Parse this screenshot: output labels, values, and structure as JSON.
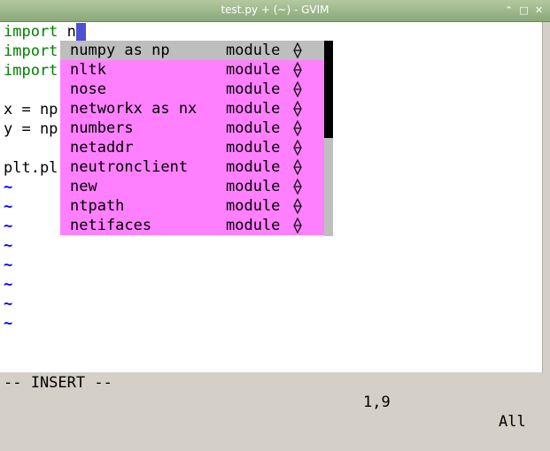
{
  "window": {
    "title": "test.py + (~) - GVIM"
  },
  "window_buttons": {
    "collapse": "⌃",
    "maximize": "□",
    "close": "✕"
  },
  "editor": {
    "lines": [
      {
        "keyword": "import",
        "text": " n",
        "cursor": true
      },
      {
        "keyword": "import",
        "text": ""
      },
      {
        "keyword": "import",
        "text": ""
      },
      {
        "keyword": "",
        "text": ""
      },
      {
        "keyword": "",
        "text": "x = np"
      },
      {
        "keyword": "",
        "text": "y = np"
      },
      {
        "keyword": "",
        "text": ""
      },
      {
        "keyword": "",
        "text": "plt.pl"
      }
    ],
    "tilde": "~",
    "tilde_count": 8
  },
  "completion": {
    "items": [
      {
        "name": "numpy as np",
        "kind": "module",
        "selected": true
      },
      {
        "name": "nltk",
        "kind": "module"
      },
      {
        "name": "nose",
        "kind": "module"
      },
      {
        "name": "networkx as nx",
        "kind": "module"
      },
      {
        "name": "numbers",
        "kind": "module"
      },
      {
        "name": "netaddr",
        "kind": "module"
      },
      {
        "name": "neutronclient",
        "kind": "module"
      },
      {
        "name": "new",
        "kind": "module"
      },
      {
        "name": "ntpath",
        "kind": "module"
      },
      {
        "name": "netifaces",
        "kind": "module"
      }
    ],
    "arrow_icon": "diamond-arrows-icon",
    "colors": {
      "menu": "#ff80ff",
      "selected": "#bebebe",
      "thumb": "#000000"
    }
  },
  "status": {
    "mode": "-- INSERT --",
    "position": "1,9",
    "scroll": "All"
  }
}
